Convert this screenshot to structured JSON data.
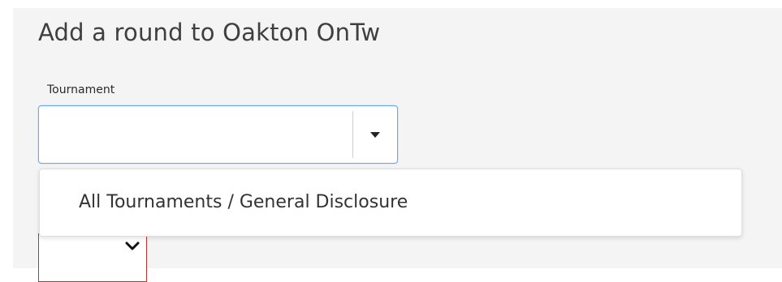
{
  "form": {
    "title": "Add a round to Oakton OnTw",
    "tournament_label": "Tournament",
    "tournament_value": "",
    "dropdown": {
      "options": [
        {
          "label": "All Tournaments / General Disclosure"
        }
      ]
    }
  },
  "icons": {
    "select_caret": "caret-down-icon",
    "secondary_chevron": "chevron-down-icon"
  },
  "colors": {
    "focus_border": "#66a9f2",
    "error_border": "#c9302c",
    "background": "#f4f4f4"
  }
}
